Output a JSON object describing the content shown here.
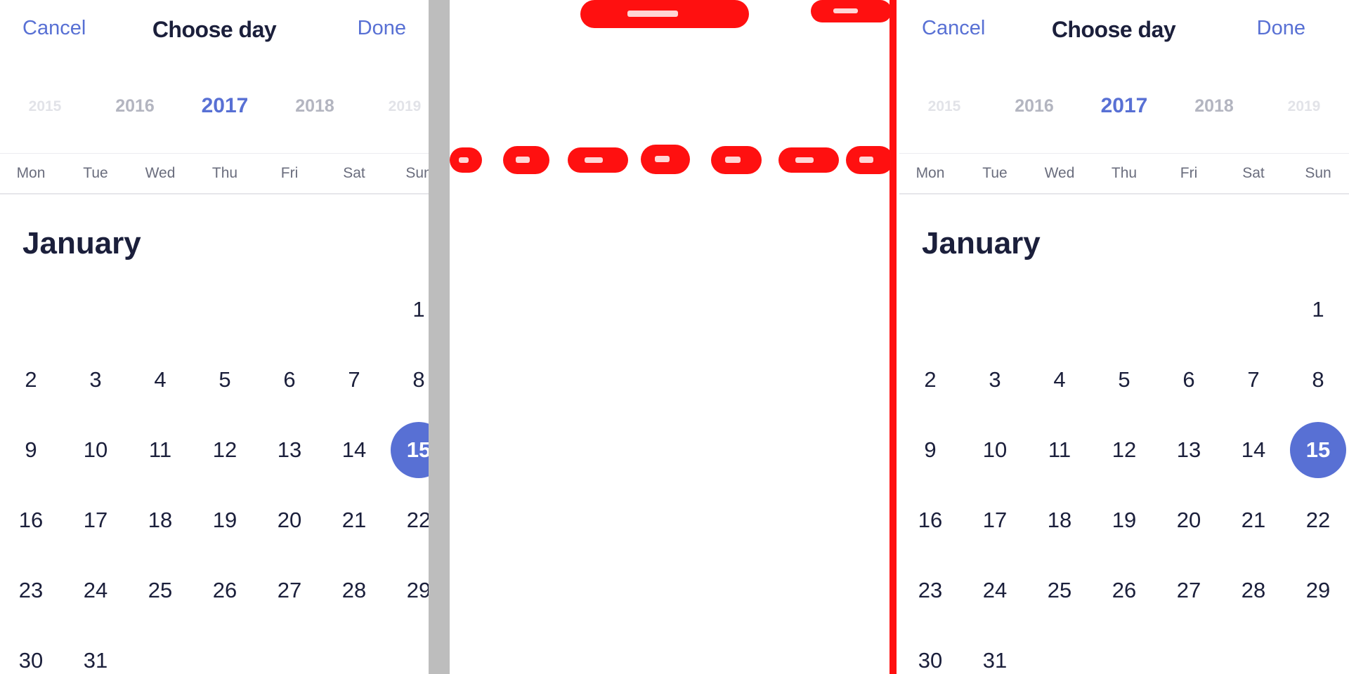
{
  "header": {
    "cancel_label": "Cancel",
    "title": "Choose day",
    "done_label": "Done"
  },
  "years": [
    "2015",
    "2016",
    "2017",
    "2018",
    "2019"
  ],
  "selected_year": "2017",
  "weekdays": [
    "Mon",
    "Tue",
    "Wed",
    "Thu",
    "Fri",
    "Sat",
    "Sun"
  ],
  "month": {
    "name": "January",
    "weeks": [
      [
        "",
        "",
        "",
        "",
        "",
        "",
        "1"
      ],
      [
        "2",
        "3",
        "4",
        "5",
        "6",
        "7",
        "8"
      ],
      [
        "9",
        "10",
        "11",
        "12",
        "13",
        "14",
        "15"
      ],
      [
        "16",
        "17",
        "18",
        "19",
        "20",
        "21",
        "22"
      ],
      [
        "23",
        "24",
        "25",
        "26",
        "27",
        "28",
        "29"
      ],
      [
        "30",
        "31",
        "",
        "",
        "",
        "",
        ""
      ]
    ]
  },
  "selected_day": "15",
  "colors": {
    "accent": "#5870d4",
    "text": "#1b1f3b",
    "separator": "#bdbdbd",
    "diff_highlight": "#ff1010"
  }
}
